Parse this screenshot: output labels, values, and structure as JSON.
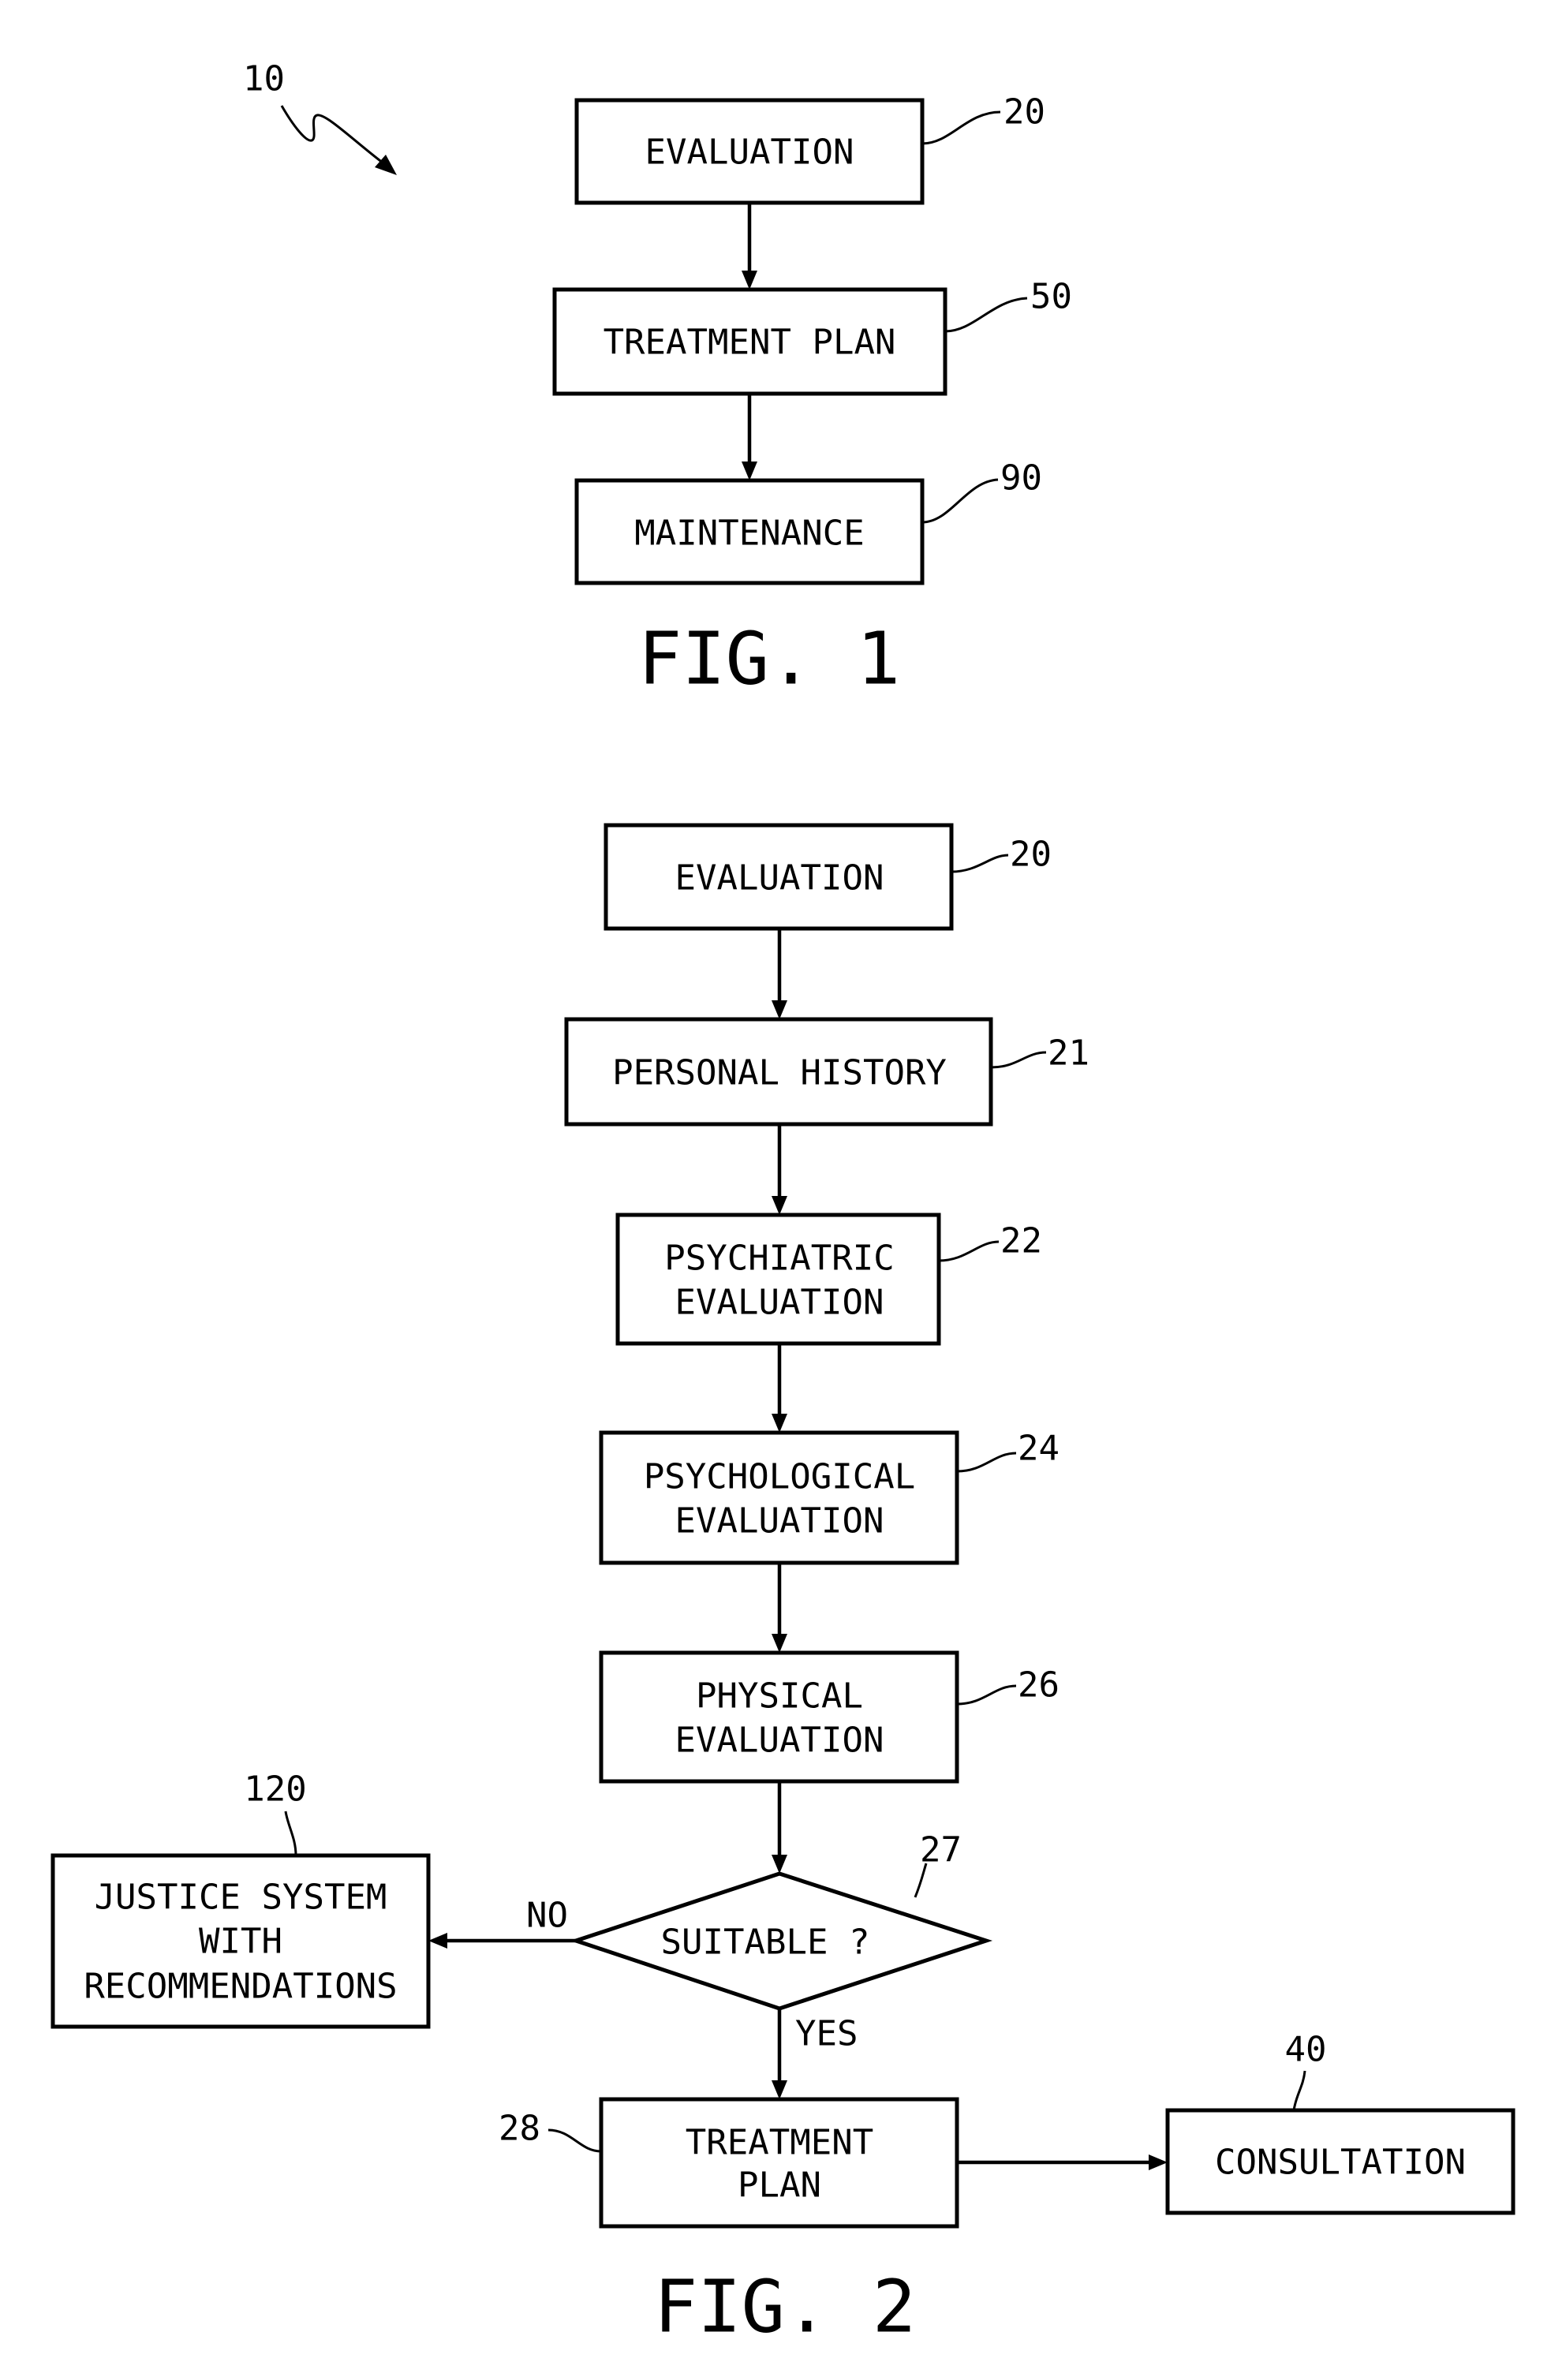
{
  "figure1": {
    "reference_numeral": "10",
    "caption": "FIG. 1",
    "nodes": [
      {
        "id": "evaluation",
        "ref": "20",
        "lines": [
          "EVALUATION"
        ]
      },
      {
        "id": "treatment-plan",
        "ref": "50",
        "lines": [
          "TREATMENT PLAN"
        ]
      },
      {
        "id": "maintenance",
        "ref": "90",
        "lines": [
          "MAINTENANCE"
        ]
      }
    ],
    "edges": [
      {
        "from": "evaluation",
        "to": "treatment-plan"
      },
      {
        "from": "treatment-plan",
        "to": "maintenance"
      }
    ]
  },
  "figure2": {
    "caption": "FIG. 2",
    "nodes": [
      {
        "id": "evaluation",
        "ref": "20",
        "lines": [
          "EVALUATION"
        ]
      },
      {
        "id": "personal-history",
        "ref": "21",
        "lines": [
          "PERSONAL HISTORY"
        ]
      },
      {
        "id": "psychiatric-evaluation",
        "ref": "22",
        "lines": [
          "PSYCHIATRIC",
          "EVALUATION"
        ]
      },
      {
        "id": "psychological-evaluation",
        "ref": "24",
        "lines": [
          "PSYCHOLOGICAL",
          "EVALUATION"
        ]
      },
      {
        "id": "physical-evaluation",
        "ref": "26",
        "lines": [
          "PHYSICAL",
          "EVALUATION"
        ]
      },
      {
        "id": "suitable-decision",
        "ref": "27",
        "lines": [
          "SUITABLE ?"
        ],
        "shape": "diamond"
      },
      {
        "id": "justice-system",
        "ref": "120",
        "lines": [
          "JUSTICE SYSTEM",
          "WITH",
          "RECOMMENDATIONS"
        ]
      },
      {
        "id": "treatment-plan",
        "ref": "28",
        "lines": [
          "TREATMENT",
          "PLAN"
        ]
      },
      {
        "id": "consultation",
        "ref": "40",
        "lines": [
          "CONSULTATION"
        ]
      }
    ],
    "edges": [
      {
        "from": "evaluation",
        "to": "personal-history"
      },
      {
        "from": "personal-history",
        "to": "psychiatric-evaluation"
      },
      {
        "from": "psychiatric-evaluation",
        "to": "psychological-evaluation"
      },
      {
        "from": "psychological-evaluation",
        "to": "physical-evaluation"
      },
      {
        "from": "physical-evaluation",
        "to": "suitable-decision"
      },
      {
        "from": "suitable-decision",
        "to": "justice-system",
        "label": "NO"
      },
      {
        "from": "suitable-decision",
        "to": "treatment-plan",
        "label": "YES"
      },
      {
        "from": "treatment-plan",
        "to": "consultation"
      }
    ]
  }
}
